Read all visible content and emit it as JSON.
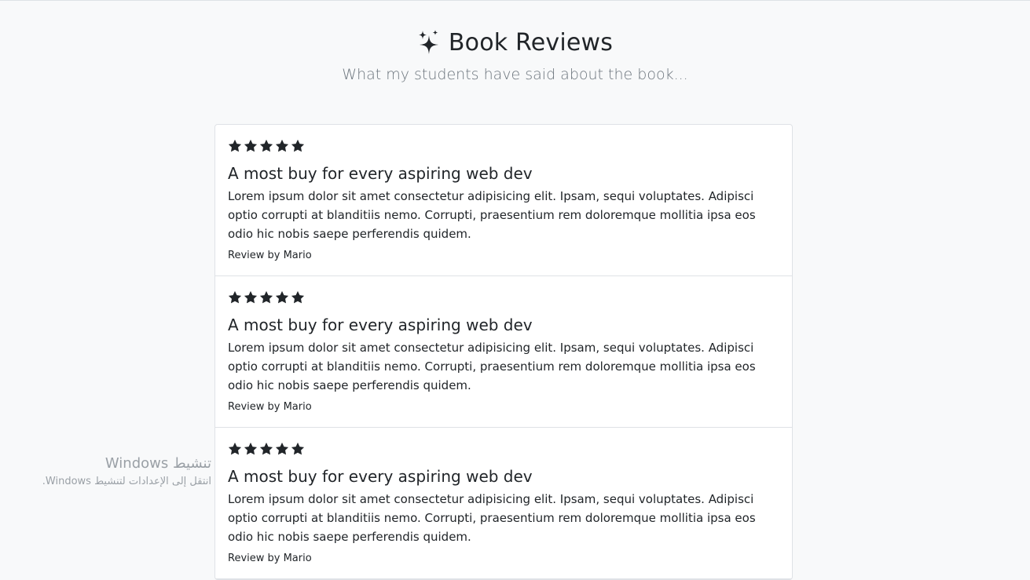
{
  "header": {
    "icon": "sparkles-icon",
    "title": "Book Reviews",
    "subtitle": "What my students have said about the book..."
  },
  "reviews": [
    {
      "rating": 5,
      "title": "A most buy for every aspiring web dev",
      "body": "Lorem ipsum dolor sit amet consectetur adipisicing elit. Ipsam, sequi voluptates. Adipisci optio corrupti at blanditiis nemo. Corrupti, praesentium rem doloremque mollitia ipsa eos odio hic nobis saepe perferendis quidem.",
      "author": "Review by Mario"
    },
    {
      "rating": 5,
      "title": "A most buy for every aspiring web dev",
      "body": "Lorem ipsum dolor sit amet consectetur adipisicing elit. Ipsam, sequi voluptates. Adipisci optio corrupti at blanditiis nemo. Corrupti, praesentium rem doloremque mollitia ipsa eos odio hic nobis saepe perferendis quidem.",
      "author": "Review by Mario"
    },
    {
      "rating": 5,
      "title": "A most buy for every aspiring web dev",
      "body": "Lorem ipsum dolor sit amet consectetur adipisicing elit. Ipsam, sequi voluptates. Adipisci optio corrupti at blanditiis nemo. Corrupti, praesentium rem doloremque mollitia ipsa eos odio hic nobis saepe perferendis quidem.",
      "author": "Review by Mario"
    }
  ],
  "watermark": {
    "title": "تنشيط Windows",
    "subtitle": "انتقل إلى الإعدادات لتنشيط Windows."
  },
  "colors": {
    "background": "#f8f9fa",
    "text": "#212529",
    "muted": "#6c757d",
    "star": "#212529"
  }
}
